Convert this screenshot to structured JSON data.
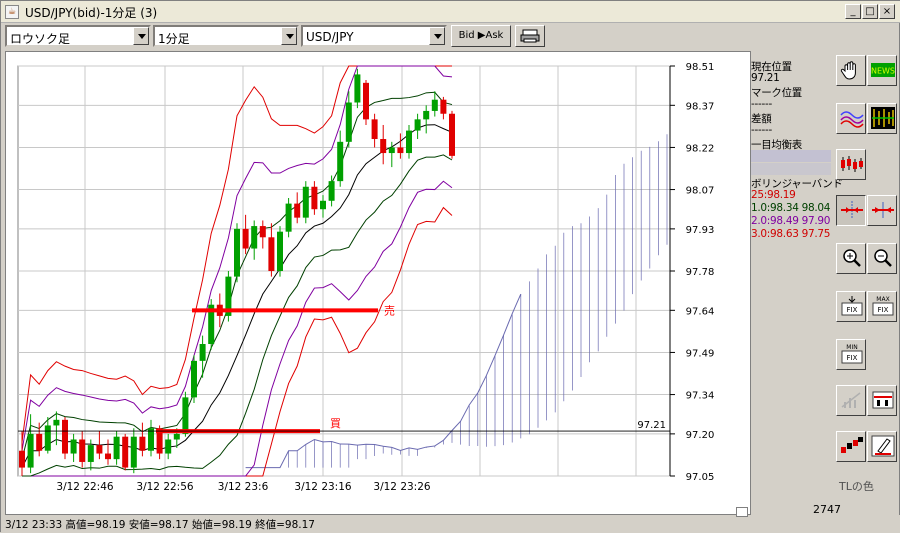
{
  "window": {
    "title": "USD/JPY(bid)-1分足 (3)",
    "app_icon": "java-icon",
    "minimize": "_",
    "maximize": "□",
    "close": "×"
  },
  "toolbar": {
    "chart_type": "ロウソク足",
    "interval": "1分足",
    "symbol": "USD/JPY",
    "bid_ask_label": "Bid ▶Ask",
    "print_icon": "printer-icon"
  },
  "info": {
    "current_pos_label": "現在位置",
    "current_pos_value": "97.21",
    "mark_pos_label": "マーク位置",
    "mark_pos_value": "------",
    "diff_label": "差額",
    "diff_value": "------",
    "ichimoku_label": "一目均衡表",
    "bollinger_label": "ボリンジャーバンド",
    "bb_25": "25:98.19",
    "bb_1": "1.0:98.34  98.04",
    "bb_2": "2.0:98.49  97.90",
    "bb_3": "3.0:98.63  97.75"
  },
  "tools": {
    "tl_color_label": "TLの色",
    "icons": [
      "hand-icon",
      "news-icon",
      "line-indicator-icon",
      "bar-indicator-icon",
      "candle-icon",
      "cross-cursor-icon",
      "squeeze-icon",
      "zoom-in-icon",
      "zoom-out-icon",
      "fix-icon",
      "max-fix-icon",
      "min-fix-icon",
      "trend-line-icon",
      "bar-color-icon",
      "candle-color-icon",
      "pen-icon"
    ]
  },
  "status": {
    "text": "3/12 23:33   高値=98.19  安値=98.17  始値=98.19  終値=98.17",
    "count": "2747"
  },
  "colors": {
    "up_candle": "#00a000",
    "down_candle": "#e00000",
    "sma": "#000000",
    "bb1": "#004000",
    "bb2": "#8000a0",
    "bb3": "#e00000",
    "trend_line": "#ff0000",
    "cloud": "#6a6ab0"
  },
  "chart_data": {
    "type": "candlestick",
    "y_ticks": [
      "98.51",
      "98.37",
      "98.22",
      "98.07",
      "97.93",
      "97.78",
      "97.64",
      "97.49",
      "97.34",
      "97.20",
      "97.05"
    ],
    "ylim": [
      97.05,
      98.51
    ],
    "x_ticks": [
      "3/12 22:46",
      "3/12 22:56",
      "3/12 23:6",
      "3/12 23:16",
      "3/12 23:26"
    ],
    "current_price": "97.21",
    "annotations": [
      {
        "text": "売",
        "price": 97.64
      },
      {
        "text": "買",
        "price": 97.21
      }
    ],
    "candles": [
      [
        97.14,
        97.21,
        97.05,
        97.08
      ],
      [
        97.08,
        97.27,
        97.06,
        97.2
      ],
      [
        97.2,
        97.24,
        97.12,
        97.14
      ],
      [
        97.14,
        97.26,
        97.13,
        97.23
      ],
      [
        97.23,
        97.28,
        97.16,
        97.25
      ],
      [
        97.25,
        97.26,
        97.11,
        97.13
      ],
      [
        97.13,
        97.2,
        97.1,
        97.18
      ],
      [
        97.18,
        97.21,
        97.08,
        97.1
      ],
      [
        97.1,
        97.18,
        97.07,
        97.16
      ],
      [
        97.16,
        97.21,
        97.11,
        97.13
      ],
      [
        97.13,
        97.18,
        97.09,
        97.11
      ],
      [
        97.11,
        97.21,
        97.09,
        97.19
      ],
      [
        97.19,
        97.2,
        97.07,
        97.08
      ],
      [
        97.08,
        97.22,
        97.06,
        97.19
      ],
      [
        97.19,
        97.24,
        97.12,
        97.14
      ],
      [
        97.14,
        97.25,
        97.12,
        97.22
      ],
      [
        97.22,
        97.23,
        97.11,
        97.13
      ],
      [
        97.13,
        97.2,
        97.11,
        97.18
      ],
      [
        97.18,
        97.22,
        97.15,
        97.2
      ],
      [
        97.2,
        97.35,
        97.19,
        97.33
      ],
      [
        97.33,
        97.48,
        97.31,
        97.46
      ],
      [
        97.46,
        97.55,
        97.4,
        97.52
      ],
      [
        97.52,
        97.68,
        97.5,
        97.66
      ],
      [
        97.66,
        97.7,
        97.58,
        97.62
      ],
      [
        97.62,
        97.78,
        97.6,
        97.76
      ],
      [
        97.76,
        97.95,
        97.74,
        97.93
      ],
      [
        97.93,
        97.98,
        97.84,
        97.86
      ],
      [
        97.86,
        97.96,
        97.82,
        97.94
      ],
      [
        97.94,
        97.96,
        97.86,
        97.9
      ],
      [
        97.9,
        97.95,
        97.76,
        97.78
      ],
      [
        97.78,
        97.94,
        97.76,
        97.92
      ],
      [
        97.92,
        98.04,
        97.9,
        98.02
      ],
      [
        98.02,
        98.06,
        97.95,
        97.97
      ],
      [
        97.97,
        98.1,
        97.95,
        98.08
      ],
      [
        98.08,
        98.1,
        97.98,
        98.0
      ],
      [
        98.0,
        98.05,
        97.97,
        98.03
      ],
      [
        98.03,
        98.12,
        98.01,
        98.1
      ],
      [
        98.1,
        98.28,
        98.08,
        98.24
      ],
      [
        98.24,
        98.42,
        98.22,
        98.38
      ],
      [
        98.38,
        98.5,
        98.36,
        98.48
      ],
      [
        98.45,
        98.46,
        98.3,
        98.32
      ],
      [
        98.32,
        98.34,
        98.22,
        98.25
      ],
      [
        98.25,
        98.3,
        98.16,
        98.2
      ],
      [
        98.2,
        98.24,
        98.15,
        98.22
      ],
      [
        98.22,
        98.27,
        98.18,
        98.2
      ],
      [
        98.2,
        98.3,
        98.18,
        98.28
      ],
      [
        98.28,
        98.34,
        98.25,
        98.32
      ],
      [
        98.32,
        98.37,
        98.27,
        98.35
      ],
      [
        98.35,
        98.42,
        98.33,
        98.39
      ],
      [
        98.39,
        98.4,
        98.32,
        98.34
      ],
      [
        98.34,
        98.35,
        98.18,
        98.19
      ]
    ]
  }
}
